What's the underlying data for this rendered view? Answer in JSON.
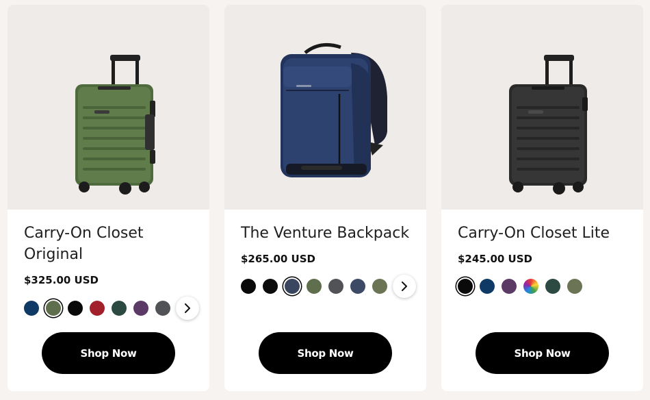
{
  "products": [
    {
      "title": "Carry-On Closet Original",
      "price": "$325.00 USD",
      "cta": "Shop Now",
      "image": "green-hardshell-suitcase",
      "swatches": [
        "#0f3a66",
        "#5f6e4c",
        "#0a0a0a",
        "#a1202a",
        "#2d4a42",
        "#5b3a66",
        "#525356"
      ],
      "selected_swatch": 1
    },
    {
      "title": "The Venture Backpack",
      "price": "$265.00 USD",
      "cta": "Shop Now",
      "image": "navy-backpack",
      "swatches": [
        "#0a0a0a",
        "#0c0c0c",
        "#3a4660",
        "#5f6e4c",
        "#525356",
        "#3c4a66",
        "#6b7555"
      ],
      "selected_swatch": 2
    },
    {
      "title": "Carry-On Closet Lite",
      "price": "$245.00 USD",
      "cta": "Shop Now",
      "image": "black-hardshell-suitcase",
      "swatches": [
        "#0a0a0a",
        "#0f3a66",
        "#5b3a66",
        "rainbow",
        "#2d4a42",
        "#6b7555"
      ],
      "selected_swatch": 0
    }
  ],
  "icons": {
    "next": "chevron-right-icon"
  }
}
